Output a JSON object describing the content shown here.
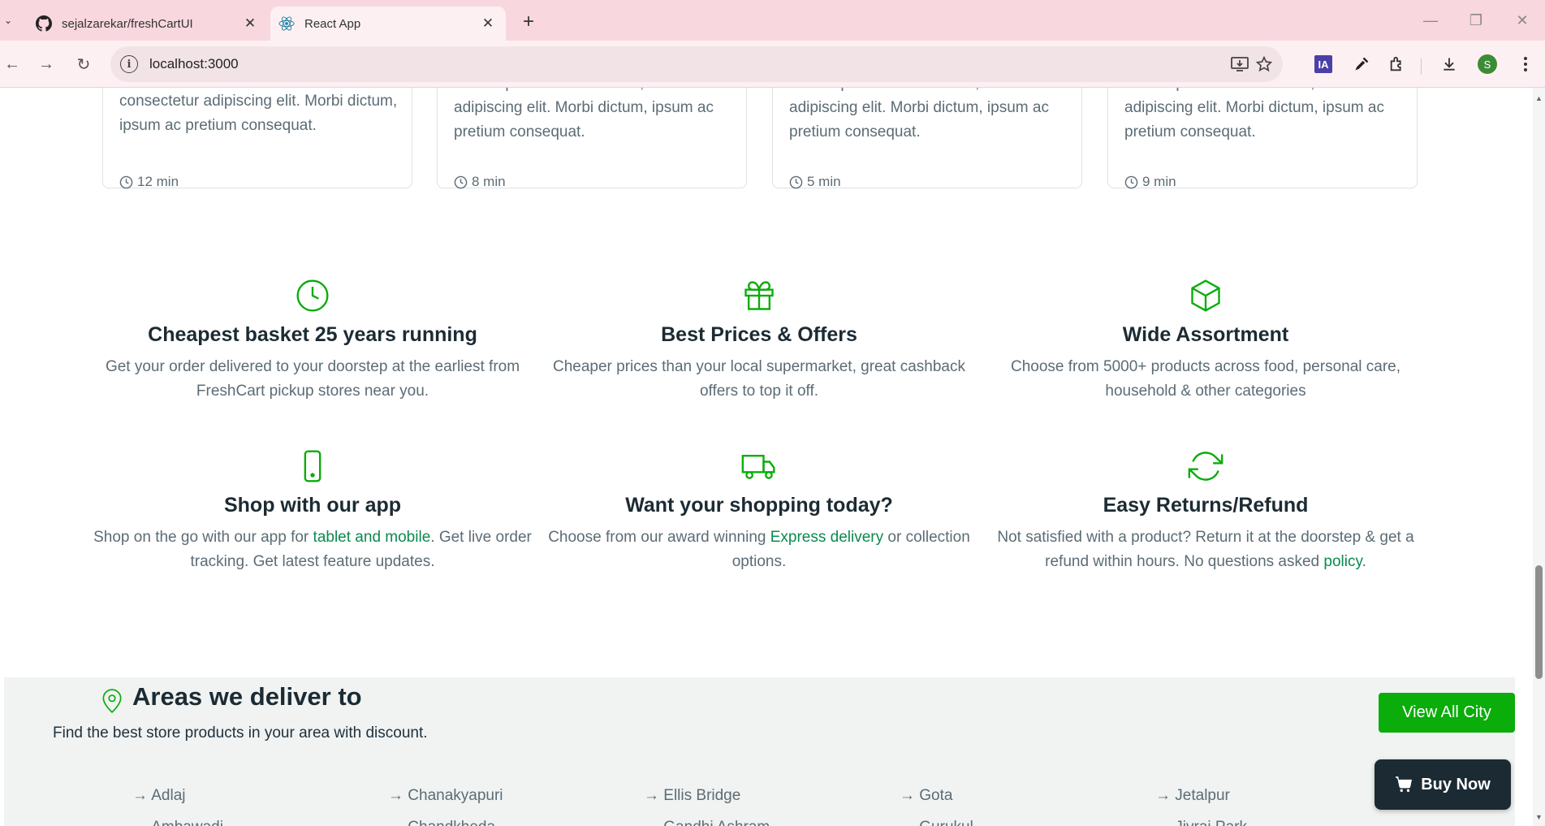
{
  "browser": {
    "tabs": [
      {
        "title": "sejalzarekar/freshCartUI",
        "active": false
      },
      {
        "title": "React App",
        "active": true
      }
    ],
    "url": "localhost:3000",
    "profile_initial": "S",
    "ext_ia_label": "IA"
  },
  "blog_cards": [
    {
      "text": "consectetur adipiscing elit. Morbi dictum, ipsum ac pretium consequat.",
      "time": "12 min"
    },
    {
      "text": "Lorem ipsum dolor sit amet, consectetur adipiscing elit. Morbi dictum, ipsum ac pretium consequat.",
      "time": "8 min"
    },
    {
      "text": "Lorem ipsum dolor sit amet, consectetur adipiscing elit. Morbi dictum, ipsum ac pretium consequat.",
      "time": "5 min"
    },
    {
      "text": "Lorem ipsum dolor sit amet, consectetur adipiscing elit. Morbi dictum, ipsum ac pretium consequat.",
      "time": "9 min"
    }
  ],
  "features": [
    {
      "icon": "clock-icon",
      "title": "Cheapest basket 25 years running",
      "text": "Get your order delivered to your doorstep at the earliest from FreshCart pickup stores near you."
    },
    {
      "icon": "gift-icon",
      "title": "Best Prices & Offers",
      "text": "Cheaper prices than your local supermarket, great cashback offers to top it off."
    },
    {
      "icon": "box-icon",
      "title": "Wide Assortment",
      "text": "Choose from 5000+ products across food, personal care, household & other categories"
    },
    {
      "icon": "phone-icon",
      "title": "Shop with our app",
      "text_before": "Shop on the go with our app for ",
      "link": "tablet and mobile",
      "text_after": ". Get live order tracking. Get latest feature updates."
    },
    {
      "icon": "truck-icon",
      "title": "Want your shopping today?",
      "text_before": "Choose from our award winning ",
      "link": "Express delivery",
      "text_after": " or collection options."
    },
    {
      "icon": "refresh-icon",
      "title": "Easy Returns/Refund",
      "text_before": "Not satisfied with a product? Return it at the doorstep & get a refund within hours. No questions asked ",
      "link": "policy",
      "text_after": "."
    }
  ],
  "areas": {
    "title": "Areas we deliver to",
    "subtitle": "Find the best store products in your area with discount.",
    "view_all_label": "View All City",
    "columns": [
      [
        "→ Adlaj",
        "→ Ambawadi"
      ],
      [
        "→ Chanakyapuri",
        "→ Chandkheda"
      ],
      [
        "→ Ellis Bridge",
        "→ Gandhi Ashram"
      ],
      [
        "→ Gota",
        "→ Gurukul"
      ],
      [
        "→ Jetalpur",
        "→ Jivraj Park"
      ]
    ]
  },
  "buy_now_label": "Buy Now",
  "colors": {
    "accent": "#0aad0a",
    "link": "#0a8a4f",
    "dark": "#1c2b33"
  }
}
